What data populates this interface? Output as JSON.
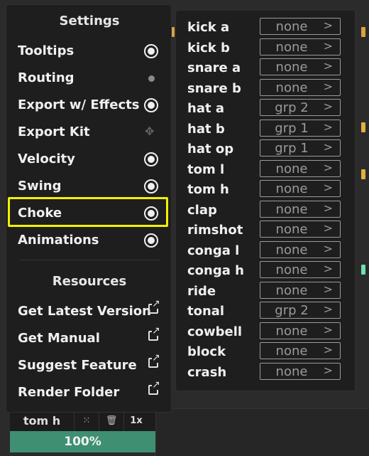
{
  "settings": {
    "title": "Settings",
    "items": [
      {
        "label": "Tooltips",
        "control": "radio-on"
      },
      {
        "label": "Routing",
        "control": "dot"
      },
      {
        "label": "Export w/ Effects",
        "control": "radio-on"
      },
      {
        "label": "Export Kit",
        "control": "move"
      },
      {
        "label": "Velocity",
        "control": "radio-on"
      },
      {
        "label": "Swing",
        "control": "radio-on"
      },
      {
        "label": "Choke",
        "control": "radio-on"
      },
      {
        "label": "Animations",
        "control": "radio-on"
      }
    ]
  },
  "resources": {
    "title": "Resources",
    "items": [
      {
        "label": "Get Latest Version"
      },
      {
        "label": "Get Manual"
      },
      {
        "label": "Suggest Feature"
      },
      {
        "label": "Render Folder"
      }
    ]
  },
  "choke_groups": [
    {
      "name": "kick a",
      "group": "none"
    },
    {
      "name": "kick b",
      "group": "none"
    },
    {
      "name": "snare a",
      "group": "none"
    },
    {
      "name": "snare b",
      "group": "none"
    },
    {
      "name": "hat a",
      "group": "grp 2"
    },
    {
      "name": "hat b",
      "group": "grp 1"
    },
    {
      "name": "hat op",
      "group": "grp 1"
    },
    {
      "name": "tom l",
      "group": "none"
    },
    {
      "name": "tom h",
      "group": "none"
    },
    {
      "name": "clap",
      "group": "none"
    },
    {
      "name": "rimshot",
      "group": "none"
    },
    {
      "name": "conga l",
      "group": "none"
    },
    {
      "name": "conga h",
      "group": "none"
    },
    {
      "name": "ride",
      "group": "none"
    },
    {
      "name": "tonal",
      "group": "grp 2"
    },
    {
      "name": "cowbell",
      "group": "none"
    },
    {
      "name": "block",
      "group": "none"
    },
    {
      "name": "crash",
      "group": "none"
    }
  ],
  "track": {
    "name": "tom h",
    "rate": "1x",
    "volume": "100%"
  },
  "colors": {
    "highlight": "#f4f000",
    "volume_bar": "#3f8f73",
    "accent_orange": "#e0a040"
  }
}
